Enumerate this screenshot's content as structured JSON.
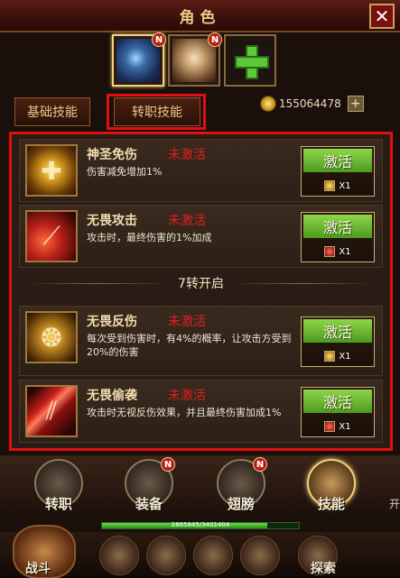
{
  "header": {
    "title": "角色",
    "close_icon": "✕"
  },
  "portraits": [
    {
      "name": "hero-portrait-1",
      "badge": "N",
      "active": true
    },
    {
      "name": "hero-portrait-2",
      "badge": "N",
      "active": false
    },
    {
      "name": "add-hero",
      "icon": "plus-icon"
    }
  ],
  "tabs": {
    "basic": "基础技能",
    "job": "转职技能"
  },
  "currency": {
    "amount": "155064478",
    "add": "+"
  },
  "skills": [
    {
      "name": "神圣免伤",
      "status": "未激活",
      "desc": "伤害减免增加1%",
      "button": "激活",
      "cost": "X1",
      "icon": "shield-cross-icon"
    },
    {
      "name": "无畏攻击",
      "status": "未激活",
      "desc": "攻击时，最终伤害的1%加成",
      "button": "激活",
      "cost": "X1",
      "icon": "claw-icon"
    },
    {
      "name": "无畏反伤",
      "status": "未激活",
      "desc": "每次受到伤害时，有4%的概率，让攻击方受到20%的伤害",
      "button": "激活",
      "cost": "X1",
      "icon": "spiral-icon"
    },
    {
      "name": "无畏偷袭",
      "status": "未激活",
      "desc": "攻击时无视反伤效果，并且最终伤害加成1%",
      "button": "激活",
      "cost": "X1",
      "icon": "slash-icon"
    }
  ],
  "divider": "7转开启",
  "nav": [
    {
      "label": "转职",
      "badge": ""
    },
    {
      "label": "装备",
      "badge": "N"
    },
    {
      "label": "翅膀",
      "badge": "N"
    },
    {
      "label": "技能",
      "badge": ""
    }
  ],
  "side_note": "开",
  "hp": {
    "text": "2865845/3401404",
    "fill": 0.84
  },
  "bottom": {
    "left_label": "战斗",
    "right_label": "探索"
  },
  "colors": {
    "accent_red": "#e01010",
    "activate_green": "#6ab832",
    "gold": "#e9c98a"
  }
}
